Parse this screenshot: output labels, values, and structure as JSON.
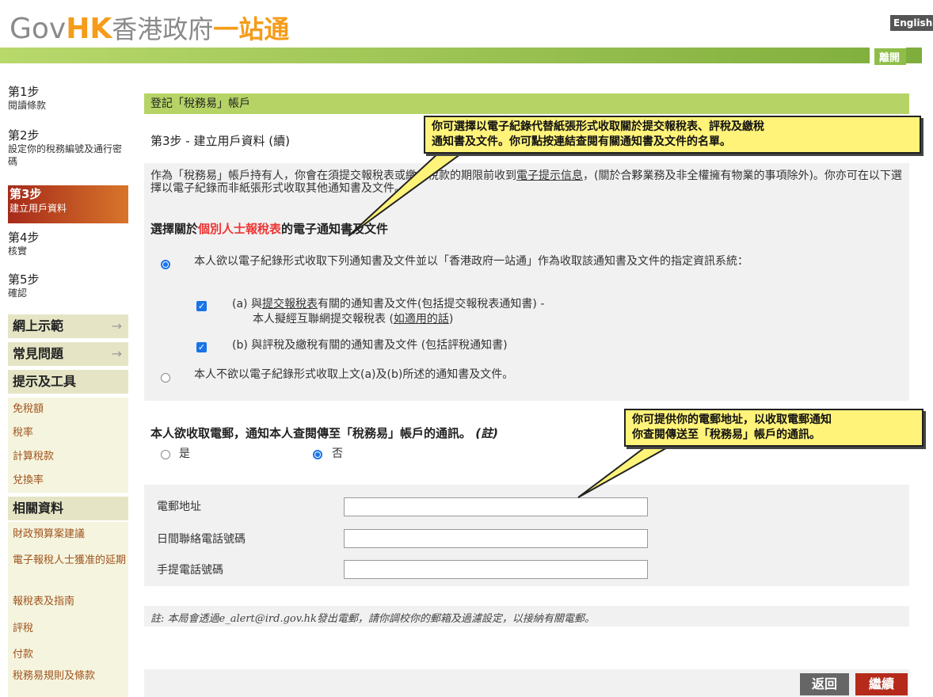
{
  "header": {
    "logo_gov": "Gov",
    "logo_hk": "HK",
    "logo_zh": "香港政府",
    "logo_zh_bold": "一站通",
    "english_label": "English",
    "logout_label": "離開"
  },
  "sidebar": {
    "steps": [
      {
        "title": "第1步",
        "sub": "閱讀條款"
      },
      {
        "title": "第2步",
        "sub": "設定你的稅務編號及通行密碼"
      },
      {
        "title": "第3步",
        "sub": "建立用戶資料"
      },
      {
        "title": "第4步",
        "sub": "核實"
      },
      {
        "title": "第5步",
        "sub": "確認"
      }
    ],
    "demo_label": "網上示範",
    "faq_label": "常見問題",
    "tools_label": "提示及工具",
    "tools_links": [
      "免稅額",
      "稅率",
      "計算稅款",
      "兌換率"
    ],
    "related_label": "相關資料",
    "related_links": [
      "財政預算案建議",
      "電子報稅人士獲准的延期",
      "報稅表及指南",
      "評稅",
      "付款",
      "稅務易規則及條款"
    ]
  },
  "main": {
    "bar_title": "登記「稅務易」帳戶",
    "step_title": "第3步 - 建立用戶資料 (續)",
    "intro_1": "作為「稅務易」帳戶持有人，你會在須提交報稅表或繳付稅款的期限前收到",
    "intro_link": "電子提示信息",
    "intro_2": "，(關於合夥業務及非全權擁有物業的事項除外)。你亦可在以下選擇以電子紀錄而非紙張形式收取其他通知書及文件。",
    "section_head_1": "選擇關於",
    "section_head_red": "個別人士報稅表",
    "section_head_2": "的電子通知書及文件",
    "option_yes": "本人欲以電子紀錄形式收取下列通知書及文件並以「香港政府一站通」作為收取該通知書及文件的指定資訊系統：",
    "item_a_prefix": "(a)  與",
    "item_a_link": "提交報稅表",
    "item_a_rest": "有關的通知書及文件(包括提交報稅表通知書) -",
    "item_a_line2_pre": "本人擬經互聯網提交報稅表 (",
    "item_a_line2_link": "如適用的話",
    "item_a_line2_post": ")",
    "item_b": "(b)  與評稅及繳稅有關的通知書及文件 (包括評稅通知書)",
    "option_no": "本人不欲以電子紀錄形式收取上文(a)及(b)所述的通知書及文件。",
    "email_question": "本人欲收取電郵，通知本人查閱傳至「稅務易」帳戶的通訊。",
    "email_note": "(註)",
    "yes_label": "是",
    "no_label": "否",
    "field_email": "電郵地址",
    "field_day_phone": "日間聯絡電話號碼",
    "field_mobile": "手提電話號碼",
    "footnote": "註: 本局會透過e_alert@ird.gov.hk發出電郵，請你調校你的郵箱及過濾設定，以接納有關電郵。",
    "back_label": "返回",
    "continue_label": "繼續"
  },
  "callouts": {
    "c1_line1": "你可選擇以電子紀錄代替紙張形式收取關於提交報稅表、評稅及繳稅",
    "c1_line2": "通知書及文件。你可點按連結查閱有關通知書及文件的名單。",
    "c2_line1": "你可提供你的電郵地址，以收取電郵通知",
    "c2_line2": "你查閱傳送至「稅務易」帳戶的通訊。"
  },
  "colors": {
    "green_bar": "#b6d466",
    "accent_red": "#b52a1a",
    "callout_yellow": "#fff37a",
    "sidebar_bg": "#f5f5df"
  }
}
